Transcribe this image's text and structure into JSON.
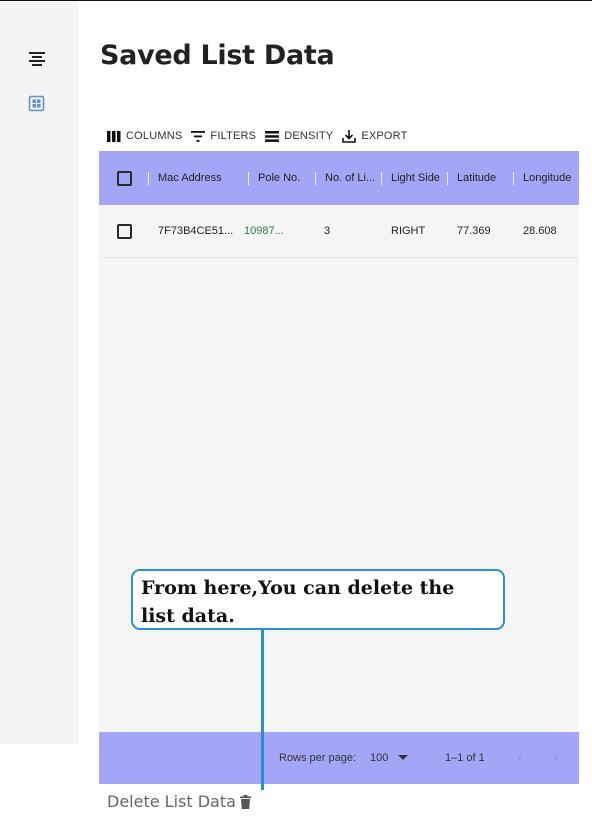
{
  "page": {
    "title": "Saved List Data"
  },
  "toolbar": {
    "columns": "COLUMNS",
    "filters": "FILTERS",
    "density": "DENSITY",
    "export": "EXPORT"
  },
  "sidebar": {
    "icons": [
      "align-center-icon",
      "grid-icon"
    ],
    "accent": "#5b8fd8"
  },
  "grid": {
    "header_color": "#a3a6f7",
    "columns": [
      "Mac Address",
      "Pole No.",
      "No. of Li...",
      "Light Side",
      "Latitude",
      "Longitude"
    ],
    "rows": [
      {
        "mac": "7F73B4CE51...",
        "pole": "10987...",
        "lights": "3",
        "side": "RIGHT",
        "lat": "77.369",
        "lng": "28.608"
      }
    ],
    "footer": {
      "rows_per_page_label": "Rows per page:",
      "rows_per_page_value": "100",
      "range": "1–1 of 1",
      "prev": "‹",
      "next": "›"
    }
  },
  "callout": {
    "line1": "From here,You can delete the",
    "line2": "list data.",
    "color": "#2a8fd6"
  },
  "delete": {
    "label": "Delete List Data"
  }
}
